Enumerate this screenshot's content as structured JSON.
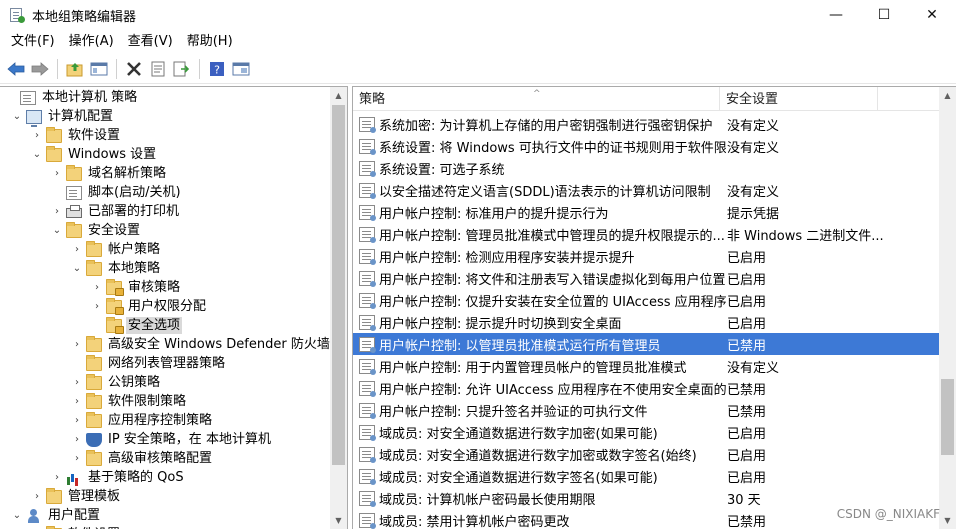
{
  "window": {
    "title": "本地组策略编辑器",
    "minimize": "—",
    "maximize": "☐",
    "close": "✕"
  },
  "menu": [
    "文件(F)",
    "操作(A)",
    "查看(V)",
    "帮助(H)"
  ],
  "toolbar_icons": [
    "back-arrow-icon",
    "forward-arrow-icon",
    "up-folder-icon",
    "show-hide-tree-icon",
    "delete-icon",
    "properties-icon",
    "export-list-icon",
    "help-icon",
    "view-icon"
  ],
  "tree": [
    {
      "label": "本地计算机 策略",
      "level": 0,
      "arrow": "",
      "icon": "doc",
      "name": "tree-local-computer-policy"
    },
    {
      "label": "计算机配置",
      "level": 1,
      "arrow": "⌄",
      "icon": "computer",
      "name": "tree-computer-configuration"
    },
    {
      "label": "软件设置",
      "level": 2,
      "arrow": "›",
      "icon": "folder",
      "name": "tree-software-settings"
    },
    {
      "label": "Windows 设置",
      "level": 2,
      "arrow": "⌄",
      "icon": "folder",
      "name": "tree-windows-settings"
    },
    {
      "label": "域名解析策略",
      "level": 3,
      "arrow": "›",
      "icon": "folder",
      "name": "tree-dns-policy"
    },
    {
      "label": "脚本(启动/关机)",
      "level": 3,
      "arrow": "",
      "icon": "doc",
      "name": "tree-scripts"
    },
    {
      "label": "已部署的打印机",
      "level": 3,
      "arrow": "›",
      "icon": "printer",
      "name": "tree-deployed-printers"
    },
    {
      "label": "安全设置",
      "level": 3,
      "arrow": "⌄",
      "icon": "folder",
      "name": "tree-security-settings"
    },
    {
      "label": "帐户策略",
      "level": 4,
      "arrow": "›",
      "icon": "folder",
      "name": "tree-account-policies"
    },
    {
      "label": "本地策略",
      "level": 4,
      "arrow": "⌄",
      "icon": "folder",
      "name": "tree-local-policies"
    },
    {
      "label": "审核策略",
      "level": 5,
      "arrow": "›",
      "icon": "folder-lock",
      "name": "tree-audit-policy"
    },
    {
      "label": "用户权限分配",
      "level": 5,
      "arrow": "›",
      "icon": "folder-lock",
      "name": "tree-user-rights"
    },
    {
      "label": "安全选项",
      "level": 5,
      "arrow": "",
      "icon": "folder-lock",
      "name": "tree-security-options",
      "selected": true
    },
    {
      "label": "高级安全 Windows Defender 防火墙",
      "level": 4,
      "arrow": "›",
      "icon": "folder",
      "name": "tree-defender-firewall"
    },
    {
      "label": "网络列表管理器策略",
      "level": 4,
      "arrow": "",
      "icon": "folder",
      "name": "tree-network-list"
    },
    {
      "label": "公钥策略",
      "level": 4,
      "arrow": "›",
      "icon": "folder",
      "name": "tree-public-key"
    },
    {
      "label": "软件限制策略",
      "level": 4,
      "arrow": "›",
      "icon": "folder",
      "name": "tree-software-restriction"
    },
    {
      "label": "应用程序控制策略",
      "level": 4,
      "arrow": "›",
      "icon": "folder",
      "name": "tree-app-control"
    },
    {
      "label": "IP 安全策略，在 本地计算机",
      "level": 4,
      "arrow": "›",
      "icon": "shield",
      "name": "tree-ip-security"
    },
    {
      "label": "高级审核策略配置",
      "level": 4,
      "arrow": "›",
      "icon": "folder",
      "name": "tree-advanced-audit"
    },
    {
      "label": "基于策略的 QoS",
      "level": 3,
      "arrow": "›",
      "icon": "chart",
      "name": "tree-qos"
    },
    {
      "label": "管理模板",
      "level": 2,
      "arrow": "›",
      "icon": "folder",
      "name": "tree-admin-templates"
    },
    {
      "label": "用户配置",
      "level": 1,
      "arrow": "⌄",
      "icon": "user",
      "name": "tree-user-configuration"
    },
    {
      "label": "软件设置",
      "level": 2,
      "arrow": "›",
      "icon": "folder",
      "name": "tree-user-software-settings"
    }
  ],
  "list": {
    "columns": {
      "policy": "策略",
      "setting": "安全设置"
    },
    "rows": [
      {
        "policy": "系统加密: 为计算机上存储的用户密钥强制进行强密钥保护",
        "setting": "没有定义"
      },
      {
        "policy": "系统设置: 将 Windows 可执行文件中的证书规则用于软件限...",
        "setting": "没有定义"
      },
      {
        "policy": "系统设置: 可选子系统",
        "setting": ""
      },
      {
        "policy": "以安全描述符定义语言(SDDL)语法表示的计算机访问限制",
        "setting": "没有定义"
      },
      {
        "policy": "用户帐户控制: 标准用户的提升提示行为",
        "setting": "提示凭据"
      },
      {
        "policy": "用户帐户控制: 管理员批准模式中管理员的提升权限提示的...",
        "setting": "非 Windows 二进制文件..."
      },
      {
        "policy": "用户帐户控制: 检测应用程序安装并提示提升",
        "setting": "已启用"
      },
      {
        "policy": "用户帐户控制: 将文件和注册表写入错误虚拟化到每用户位置",
        "setting": "已启用"
      },
      {
        "policy": "用户帐户控制: 仅提升安装在安全位置的 UIAccess 应用程序",
        "setting": "已启用"
      },
      {
        "policy": "用户帐户控制: 提示提升时切换到安全桌面",
        "setting": "已启用"
      },
      {
        "policy": "用户帐户控制: 以管理员批准模式运行所有管理员",
        "setting": "已禁用",
        "selected": true
      },
      {
        "policy": "用户帐户控制: 用于内置管理员帐户的管理员批准模式",
        "setting": "没有定义"
      },
      {
        "policy": "用户帐户控制: 允许 UIAccess 应用程序在不使用安全桌面的...",
        "setting": "已禁用"
      },
      {
        "policy": "用户帐户控制: 只提升签名并验证的可执行文件",
        "setting": "已禁用"
      },
      {
        "policy": "域成员: 对安全通道数据进行数字加密(如果可能)",
        "setting": "已启用"
      },
      {
        "policy": "域成员: 对安全通道数据进行数字加密或数字签名(始终)",
        "setting": "已启用"
      },
      {
        "policy": "域成员: 对安全通道数据进行数字签名(如果可能)",
        "setting": "已启用"
      },
      {
        "policy": "域成员: 计算机帐户密码最长使用期限",
        "setting": "30 天"
      },
      {
        "policy": "域成员: 禁用计算机帐户密码更改",
        "setting": "已禁用"
      }
    ]
  },
  "watermark": "CSDN @_NIXIAKF",
  "colors": {
    "selection": "#3d79d6",
    "tree_selection": "#d9d9d9"
  }
}
